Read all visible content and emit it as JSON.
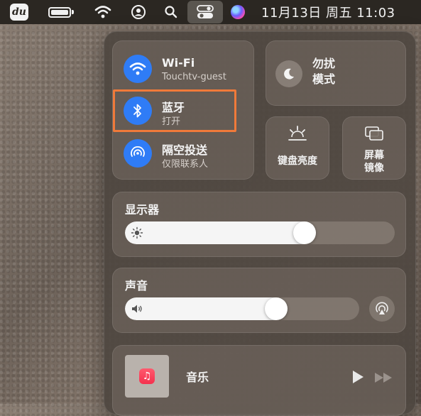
{
  "menubar": {
    "app_logo": "du",
    "datetime": "11月13日 周五  11:03",
    "icons": [
      "battery-icon",
      "wifi-icon",
      "user-icon",
      "search-icon",
      "control-center-icon",
      "siri-icon"
    ]
  },
  "control_center": {
    "wifi": {
      "title": "Wi-Fi",
      "subtitle": "Touchtv-guest"
    },
    "bluetooth": {
      "title": "蓝牙",
      "subtitle": "打开"
    },
    "airdrop": {
      "title": "隔空投送",
      "subtitle": "仅限联系人"
    },
    "dnd": {
      "label": "勿扰\n模式"
    },
    "keyboard_brightness": {
      "label": "键盘亮度"
    },
    "screen_mirroring": {
      "label": "屏幕\n镜像"
    },
    "display": {
      "title": "显示器",
      "level": 0.68
    },
    "sound": {
      "title": "声音",
      "level": 0.66
    },
    "music": {
      "title": "音乐"
    }
  },
  "colors": {
    "accent_blue": "#2f7cf6",
    "highlight_orange": "#f07a3a",
    "music_red": "#f5304d"
  }
}
